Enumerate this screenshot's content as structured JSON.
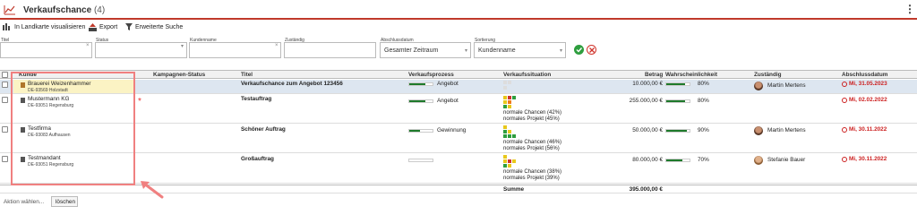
{
  "header": {
    "title": "Verkaufschance",
    "count": "(4)"
  },
  "toolbar": {
    "map_label": "In Landkarte visualisieren",
    "export_label": "Export",
    "search_label": "Erweiterte Suche"
  },
  "filters": {
    "titel": {
      "label": "Titel",
      "value": ""
    },
    "status": {
      "label": "Status",
      "value": ""
    },
    "kundenname": {
      "label": "Kundenname",
      "value": ""
    },
    "zustaendig": {
      "label": "Zuständig",
      "value": ""
    },
    "abschlussdatum": {
      "label": "Abschlussdatum",
      "value": "Gesamter Zeitraum"
    },
    "sortierung": {
      "label": "Sortierung",
      "value": "Kundenname"
    }
  },
  "columns": {
    "kunde": "Kunde",
    "kampagnen_status": "Kampagnen-Status",
    "titel": "Titel",
    "verkaufsprozess": "Verkaufsprozess",
    "verkaufssituation": "Verkaufssituation",
    "betrag": "Betrag",
    "wahrscheinlichkeit": "Wahrscheinlichkeit",
    "zustaendig": "Zuständig",
    "abschlussdatum": "Abschlussdatum"
  },
  "rows": [
    {
      "kunde": "Brauerei Weizenhammer",
      "kunde_sub": "DE-93569 Holzstadt",
      "titel": "Verkaufschance zum Angebot 123456",
      "prozess": "Angebot",
      "prozess_fill": 0.7,
      "situation_lines": [
        "",
        ""
      ],
      "betrag": "10.000,00 €",
      "wahrscheinlichkeit": "80%",
      "wahrscheinlichkeit_value": 80,
      "zustaendig": "Martin Mertens",
      "datum": "Mi, 31.05.2023"
    },
    {
      "kunde": "Mustermann KG",
      "kunde_sub": "DE-93051 Regensburg",
      "titel": "Testauftrag",
      "prozess": "Angebot",
      "prozess_fill": 0.7,
      "situation_lines": [
        "normale Chancen (42%)",
        "normales Projekt (45%)"
      ],
      "betrag": "255.000,00 €",
      "wahrscheinlichkeit": "80%",
      "wahrscheinlichkeit_value": 80,
      "zustaendig": "",
      "datum": "Mi, 02.02.2022"
    },
    {
      "kunde": "Testfirma",
      "kunde_sub": "DE-93083 Aufhausen",
      "titel": "Schöner Auftrag",
      "prozess": "Gewinnung",
      "prozess_fill": 0.45,
      "situation_lines": [
        "normale Chancen (46%)",
        "normales Projekt (56%)"
      ],
      "betrag": "50.000,00 €",
      "wahrscheinlichkeit": "90%",
      "wahrscheinlichkeit_value": 90,
      "zustaendig": "Martin Mertens",
      "datum": "Mi, 30.11.2022"
    },
    {
      "kunde": "Testmandant",
      "kunde_sub": "DE-93051 Regensburg",
      "titel": "Großauftrag",
      "prozess": "",
      "prozess_fill": 0,
      "situation_lines": [
        "normale Chancen (38%)",
        "normales Projekt (39%)"
      ],
      "betrag": "80.000,00 €",
      "wahrscheinlichkeit": "70%",
      "wahrscheinlichkeit_value": 70,
      "zustaendig": "Stefanie Bauer",
      "datum": "Mi, 30.11.2022"
    }
  ],
  "summe": {
    "label": "Summe",
    "value": "395.000,00 €"
  },
  "footer": {
    "action_label": "Aktion wählen...",
    "delete_label": "löschen"
  },
  "colors": {
    "accent_red": "#c0392b",
    "green": "#1e7a2b",
    "highlight_row": "#dde6f0",
    "highlight_cell": "#fbf3c4",
    "annotation": "#f08080"
  }
}
